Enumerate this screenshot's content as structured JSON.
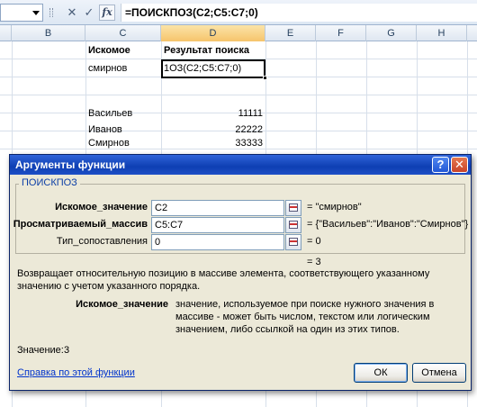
{
  "formula_bar": {
    "cell_ref": "",
    "fx_label": "fx",
    "cancel_glyph": "✕",
    "enter_glyph": "✓",
    "formula": "=ПОИСКПОЗ(C2;C5:C7;0)"
  },
  "sheet": {
    "columns": [
      {
        "label": "B",
        "selected": false
      },
      {
        "label": "C",
        "selected": false
      },
      {
        "label": "D",
        "selected": true
      },
      {
        "label": "E",
        "selected": false
      },
      {
        "label": "F",
        "selected": false
      },
      {
        "label": "G",
        "selected": false
      },
      {
        "label": "H",
        "selected": false
      }
    ],
    "headers": {
      "search_value": "Искомое",
      "search_result": "Результат поиска"
    },
    "search_input": "смирнов",
    "active_cell_text": "1ОЗ(C2;C5:C7;0)",
    "rows": [
      {
        "name": "Васильев",
        "value": "11111"
      },
      {
        "name": "Иванов",
        "value": "22222"
      },
      {
        "name": "Смирнов",
        "value": "33333"
      }
    ]
  },
  "dialog": {
    "title": "Аргументы функции",
    "help_glyph": "?",
    "close_glyph": "✕",
    "function_name": "ПОИСКПОЗ",
    "args": [
      {
        "label": "Искомое_значение",
        "bold": true,
        "value": "C2",
        "result": "= \"смирнов\""
      },
      {
        "label": "Просматриваемый_массив",
        "bold": true,
        "value": "C5:C7",
        "result": "= {\"Васильев\":\"Иванов\":\"Смирнов\"}"
      },
      {
        "label": "Тип_сопоставления",
        "bold": false,
        "value": "0",
        "result": "= 0"
      }
    ],
    "formula_result": "= 3",
    "description": "Возвращает относительную позицию в массиве элемента, соответствующего указанному значению с учетом указанного порядка.",
    "arg_help_name": "Искомое_значение",
    "arg_help_text": "значение, используемое при поиске нужного значения в массиве - может быть числом, текстом или логическим значением, либо ссылкой на один из этих типов.",
    "value_label": "Значение:",
    "value": "3",
    "help_link": "Справка по этой функции",
    "ok_label": "ОК",
    "cancel_label": "Отмена"
  }
}
